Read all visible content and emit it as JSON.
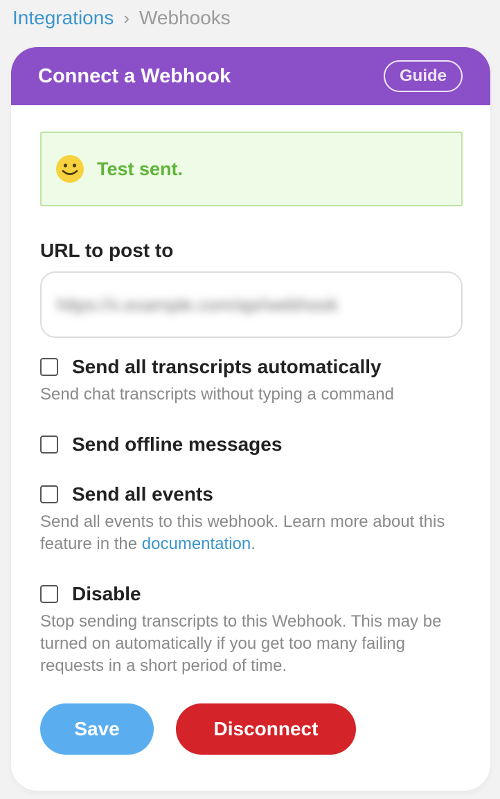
{
  "breadcrumb": {
    "parent": "Integrations",
    "separator": "›",
    "current": "Webhooks"
  },
  "card": {
    "title": "Connect a Webhook",
    "guide_label": "Guide",
    "header_color": "#8b4fc8"
  },
  "alert": {
    "icon": "smiley-icon",
    "message": "Test sent."
  },
  "url": {
    "label": "URL to post to",
    "value": "https://x.example.com/api/webhook"
  },
  "options": [
    {
      "label": "Send all transcripts automatically",
      "description": "Send chat transcripts without typing a command",
      "checked": false
    },
    {
      "label": "Send offline messages",
      "checked": false
    },
    {
      "label": "Send all events",
      "description_before": "Send all events to this webhook. Learn more about this feature in the",
      "link_text": "documentation",
      "description_after": ".",
      "checked": false
    },
    {
      "label": "Disable",
      "description": "Stop sending transcripts to this Webhook. This may be turned on automatically if you get too many failing requests in a short period of time.",
      "checked": false
    }
  ],
  "buttons": {
    "save": "Save",
    "disconnect": "Disconnect"
  }
}
